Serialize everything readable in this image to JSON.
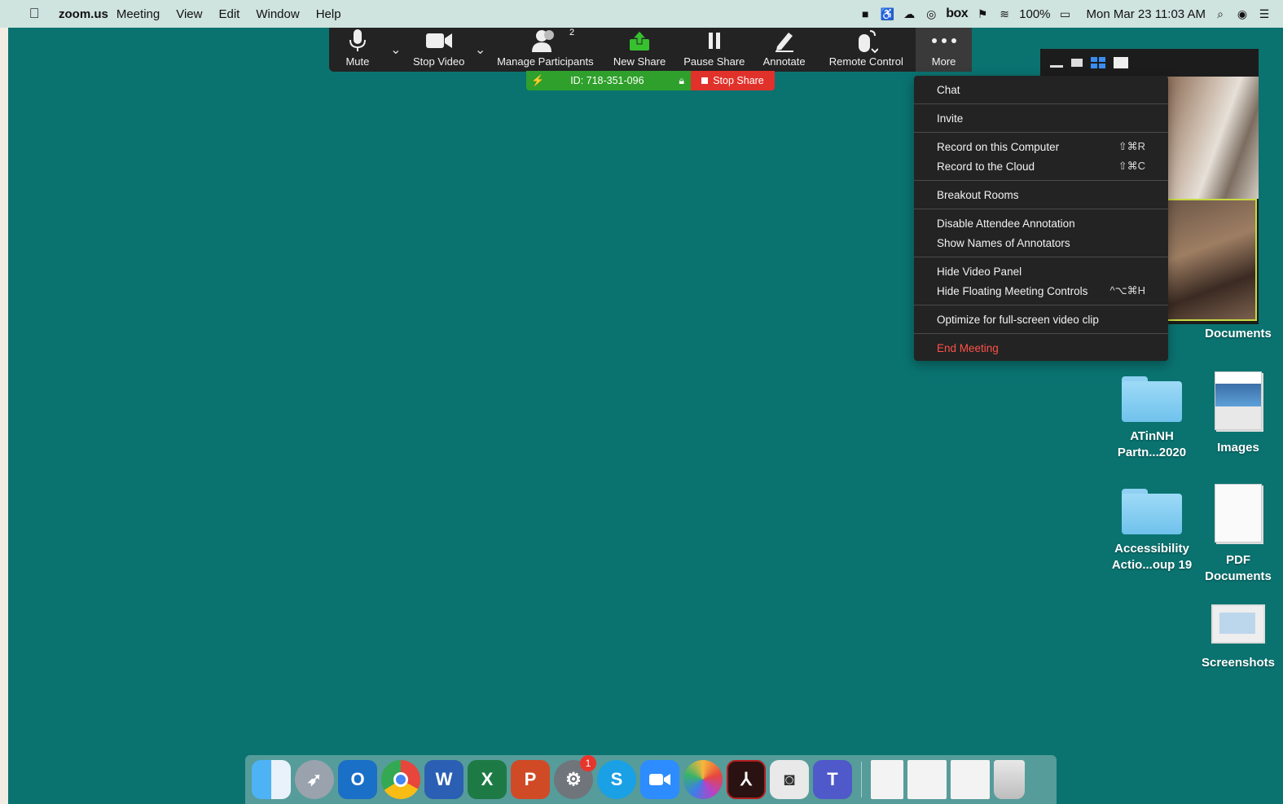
{
  "menubar": {
    "app_name": "zoom.us",
    "menus": [
      "Meeting",
      "View",
      "Edit",
      "Window",
      "Help"
    ],
    "battery": "100%",
    "clock": "Mon Mar 23  11:03 AM",
    "box_label": "box"
  },
  "toolbar": {
    "mute": "Mute",
    "stop_video": "Stop Video",
    "manage_participants": "Manage Participants",
    "participant_count": "2",
    "new_share": "New Share",
    "pause_share": "Pause Share",
    "annotate": "Annotate",
    "remote_control": "Remote Control",
    "more": "More"
  },
  "sharebar": {
    "meeting_id": "ID: 718-351-096",
    "stop_share": "Stop Share"
  },
  "more_menu": {
    "chat": "Chat",
    "invite": "Invite",
    "record_computer": "Record on this Computer",
    "record_computer_sc": "⇧⌘R",
    "record_cloud": "Record to the Cloud",
    "record_cloud_sc": "⇧⌘C",
    "breakout_rooms": "Breakout Rooms",
    "disable_annotation": "Disable Attendee Annotation",
    "show_annotators": "Show Names of Annotators",
    "hide_video_panel": "Hide Video Panel",
    "hide_floating": "Hide Floating Meeting Controls",
    "hide_floating_sc": "^⌥⌘H",
    "optimize_video": "Optimize for full-screen video clip",
    "end_meeting": "End Meeting"
  },
  "desktop": {
    "documents": "Documents",
    "atinnh_1": "ATinNH",
    "atinnh_2": "Partn...2020",
    "images": "Images",
    "access_1": "Accessibility",
    "access_2": "Actio...oup 19",
    "pdf_1": "PDF",
    "pdf_2": "Documents",
    "screenshots": "Screenshots"
  },
  "dock": {
    "sys_prefs_badge": "1",
    "outlook_letter": "O",
    "word_letter": "W",
    "excel_letter": "X",
    "ppt_letter": "P",
    "skype_letter": "S",
    "teams_letter": "T"
  },
  "colors": {
    "desktop": "#0a7370",
    "toolbar": "#232323",
    "share_green": "#2fa02b",
    "stop_red": "#e0322b",
    "end_meeting": "#ff5148"
  }
}
